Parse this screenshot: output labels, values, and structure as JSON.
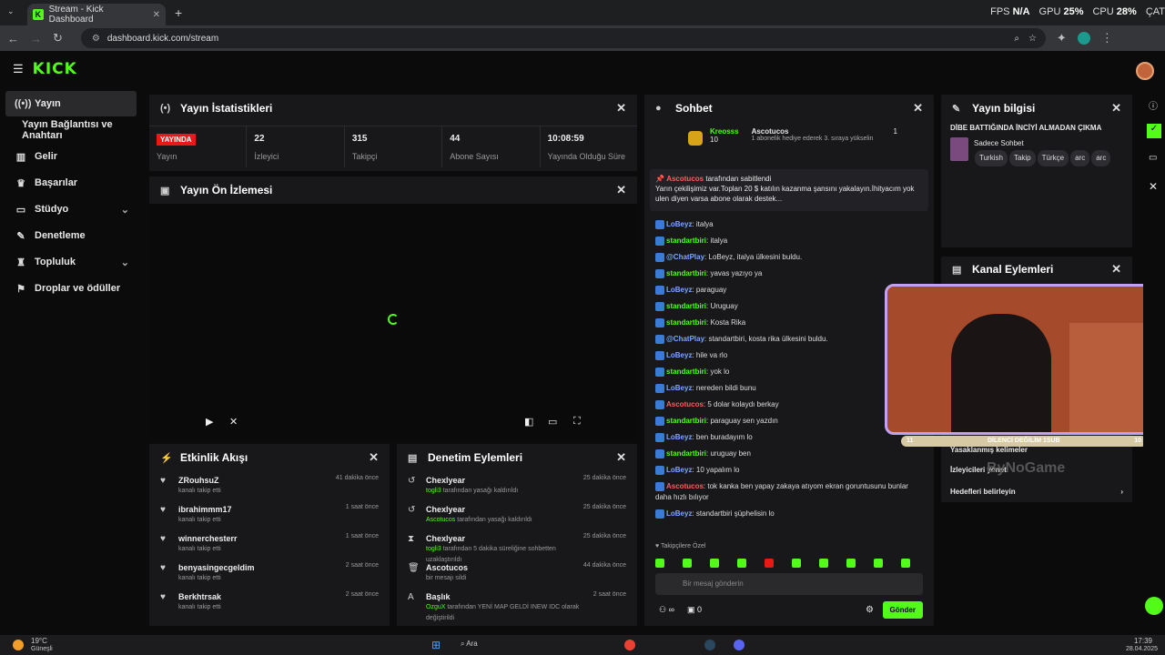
{
  "browser": {
    "tab_title": "Stream - Kick Dashboard",
    "url": "dashboard.kick.com/stream"
  },
  "hw_overlay": {
    "fps_label": "FPS",
    "fps": "N/A",
    "gpu_label": "GPU",
    "gpu": "25%",
    "cpu_label": "CPU",
    "cpu": "28%",
    "cpu_temp": "ÇAT"
  },
  "header": {
    "logo": "KICK"
  },
  "sidebar": {
    "items": [
      {
        "label": "Yayın",
        "icon": "broadcast-icon"
      },
      {
        "label": "Yayın Bağlantısı ve Anahtarı",
        "icon": ""
      },
      {
        "label": "Gelir",
        "icon": "chart-icon"
      },
      {
        "label": "Başarılar",
        "icon": "trophy-icon"
      },
      {
        "label": "Stüdyo",
        "icon": "tv-icon"
      },
      {
        "label": "Denetleme",
        "icon": "wrench-icon"
      },
      {
        "label": "Topluluk",
        "icon": "people-icon"
      },
      {
        "label": "Droplar ve ödüller",
        "icon": "gift-icon"
      }
    ]
  },
  "stats": {
    "title": "Yayın İstatistikleri",
    "items": [
      {
        "value": "YAYINDA",
        "label": "Yayın"
      },
      {
        "value": "22",
        "label": "İzleyici"
      },
      {
        "value": "315",
        "label": "Takipçi"
      },
      {
        "value": "44",
        "label": "Abone Sayısı"
      },
      {
        "value": "10:08:59",
        "label": "Yayında Olduğu Süre"
      }
    ]
  },
  "preview": {
    "title": "Yayın Ön İzlemesi"
  },
  "activity": {
    "title": "Etkinlik Akışı",
    "items": [
      {
        "name": "ZRouhsuZ",
        "sub": "kanalı takip etti",
        "time": "41 dakika önce"
      },
      {
        "name": "ibrahimmm17",
        "sub": "kanalı takip etti",
        "time": "1 saat önce"
      },
      {
        "name": "winnerchesterr",
        "sub": "kanalı takip etti",
        "time": "1 saat önce"
      },
      {
        "name": "benyasingecgeldim",
        "sub": "kanalı takip etti",
        "time": "2 saat önce"
      },
      {
        "name": "Berkhtrsak",
        "sub": "kanalı takip etti",
        "time": "2 saat önce"
      }
    ]
  },
  "moderation": {
    "title": "Denetim Eylemleri",
    "items": [
      {
        "name": "Chexlyear",
        "who": "togli3",
        "sub": "tarafından yasağı kaldırıldı",
        "time": "25 dakika önce",
        "icon": "undo-icon"
      },
      {
        "name": "Chexlyear",
        "who": "Ascotucos",
        "sub": "tarafından yasağı kaldırıldı",
        "time": "25 dakika önce",
        "icon": "undo-icon"
      },
      {
        "name": "Chexlyear",
        "who": "togli3",
        "sub": "tarafından 5 dakika süreliğine sohbetten uzaklaştırıldı",
        "time": "25 dakika önce",
        "icon": "hourglass-icon"
      },
      {
        "name": "Ascotucos",
        "who": "",
        "sub": "bir mesajı sildi",
        "time": "44 dakika önce",
        "icon": "trash-icon"
      },
      {
        "name": "Başlık",
        "who": "OzguX",
        "sub": "tarafından YENİ MAP GELDİ INEW IDC olarak değiştirildi",
        "time": "2 saat önce",
        "icon": "title-icon"
      }
    ]
  },
  "chat": {
    "title": "Sohbet",
    "top_gifter": {
      "name": "Kreosss",
      "count": "10"
    },
    "top_gifter2": {
      "name": "Ascotucos",
      "count": "1",
      "note": "1 abonelik hediye ederek 3. sıraya yükselin"
    },
    "pinned": {
      "by": "Ascotucos",
      "label": "tarafından sabitlendi",
      "text": "Yarın çekilişimiz var.Toplan 20 $ katılın kazanma şansını yakalayın.İhityacım yok ulen diyen varsa abone olarak destek..."
    },
    "messages": [
      {
        "user": "LoBeyz",
        "cls": "u1",
        "text": "italya"
      },
      {
        "user": "standartbiri",
        "cls": "u2",
        "text": "italya"
      },
      {
        "user": "@ChatPlay",
        "cls": "u1",
        "text": "LoBeyz, italya ülkesini buldu."
      },
      {
        "user": "standartbiri",
        "cls": "u2",
        "text": "yavas yazıyo ya"
      },
      {
        "user": "LoBeyz",
        "cls": "u1",
        "text": "paraguay"
      },
      {
        "user": "standartbiri",
        "cls": "u2",
        "text": "Uruguay"
      },
      {
        "user": "standartbiri",
        "cls": "u2",
        "text": "Kosta Rika"
      },
      {
        "user": "@ChatPlay",
        "cls": "u1",
        "text": "standartbiri, kosta rika ülkesini buldu."
      },
      {
        "user": "LoBeyz",
        "cls": "u1",
        "text": "hile va rlo"
      },
      {
        "user": "standartbiri",
        "cls": "u2",
        "text": "yok lo"
      },
      {
        "user": "LoBeyz",
        "cls": "u1",
        "text": "nereden bildi bunu"
      },
      {
        "user": "Ascotucos",
        "cls": "u3",
        "text": "5 dolar kolaydı berkay"
      },
      {
        "user": "standartbiri",
        "cls": "u2",
        "text": "paraguay sen yazdın"
      },
      {
        "user": "LoBeyz",
        "cls": "u1",
        "text": "ben buradayım lo"
      },
      {
        "user": "standartbiri",
        "cls": "u2",
        "text": "uruguay ben"
      },
      {
        "user": "LoBeyz",
        "cls": "u1",
        "text": "10 yapalım lo"
      },
      {
        "user": "Ascotucos",
        "cls": "u3",
        "text": "tok kanka ben yapay zakaya atıyom ekran goruntusunu bunlar daha hızlı bılıyor"
      },
      {
        "user": "LoBeyz",
        "cls": "u1",
        "text": "standartbiri şüphelisin lo"
      }
    ],
    "followers_only": "Takipçilere Özel",
    "input_placeholder": "Bir mesaj gönderin",
    "viewers": "∞",
    "count": "0",
    "send": "Gönder"
  },
  "info": {
    "title": "Yayın bilgisi",
    "stream_title": "DİBE BATTIĞINDA İNCİYİ ALMADAN ÇIKMA",
    "category": "Sadece Sohbet",
    "tags": [
      "Turkish",
      "Takip",
      "Türkçe",
      "arc",
      "arc"
    ]
  },
  "actions": {
    "title": "Kanal Eylemleri",
    "items": [
      "Yasaklanmış kelimeler",
      "İzleyicileri yönet",
      "Hedefleri belirleyin"
    ]
  },
  "webcam": {
    "bar_left": "11",
    "bar_text": "DİLENCİ DEĞİLİM 1SUB",
    "bar_right": "10",
    "watermark": "ByNoGame"
  },
  "taskbar": {
    "weather_temp": "19°C",
    "weather_text": "Güneşli",
    "search": "Ara",
    "time": "17:39",
    "date": "28.04.2025"
  }
}
